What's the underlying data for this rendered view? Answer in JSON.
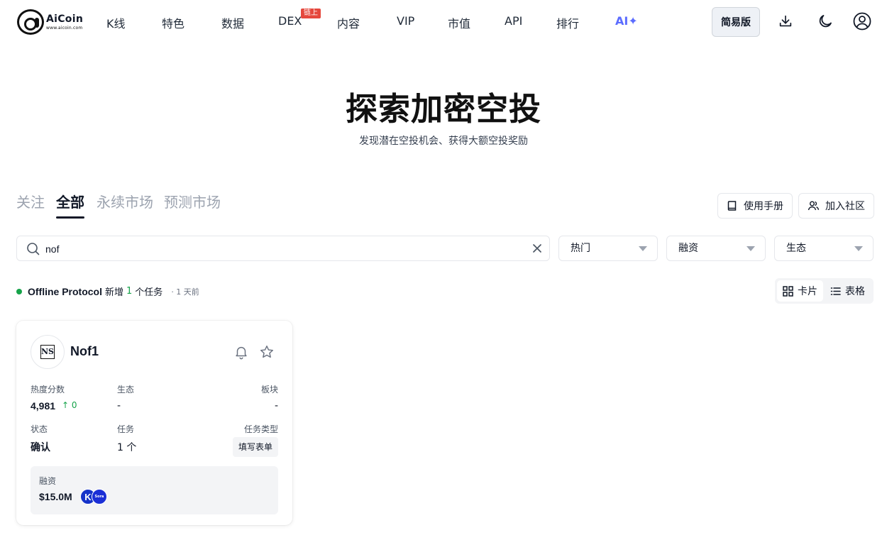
{
  "logo": {
    "name": "AiCoin",
    "url": "www.aicoin.com"
  },
  "nav": {
    "items": [
      "K线",
      "特色",
      "数据",
      "DEX",
      "内容",
      "VIP",
      "市值",
      "API",
      "排行",
      "AI✦"
    ],
    "badge": "链上",
    "simple_label": "简易版"
  },
  "hero": {
    "title": "探索加密空投",
    "subtitle": "发现潜在空投机会、获得大额空投奖励"
  },
  "tabs": [
    "关注",
    "全部",
    "永续市场",
    "预测市场"
  ],
  "active_tab": "全部",
  "actions": {
    "manual": "使用手册",
    "community": "加入社区"
  },
  "search": {
    "value": "nof",
    "placeholder": ""
  },
  "filters": [
    "热门",
    "融资",
    "生态"
  ],
  "activity": {
    "project": "Offline Protocol",
    "prefix": "新增",
    "count": "1",
    "suffix": "个任务",
    "time": "· 1 天前"
  },
  "view": {
    "card": "卡片",
    "table": "表格",
    "active": "卡片"
  },
  "card": {
    "avatar_text": "NS",
    "name": "Nof1",
    "heat_label": "热度分数",
    "heat_value": "4,981",
    "heat_change": "↑ 0",
    "eco_label": "生态",
    "eco_value": "-",
    "sector_label": "板块",
    "sector_value": "-",
    "status_label": "状态",
    "status_value": "确认",
    "task_label": "任务",
    "task_value": "1 个",
    "task_type_label": "任务类型",
    "task_type_value": "填写表单",
    "funding_label": "融资",
    "funding_value": "$15.0M",
    "investors": [
      {
        "text": "K",
        "color": "#1533c9"
      },
      {
        "text": "Sora",
        "color": "#1b2fd6"
      }
    ]
  },
  "colors": {
    "accent_ai": "#5b6cff",
    "badge_red": "#e5483d",
    "positive_green": "#16a34a"
  }
}
